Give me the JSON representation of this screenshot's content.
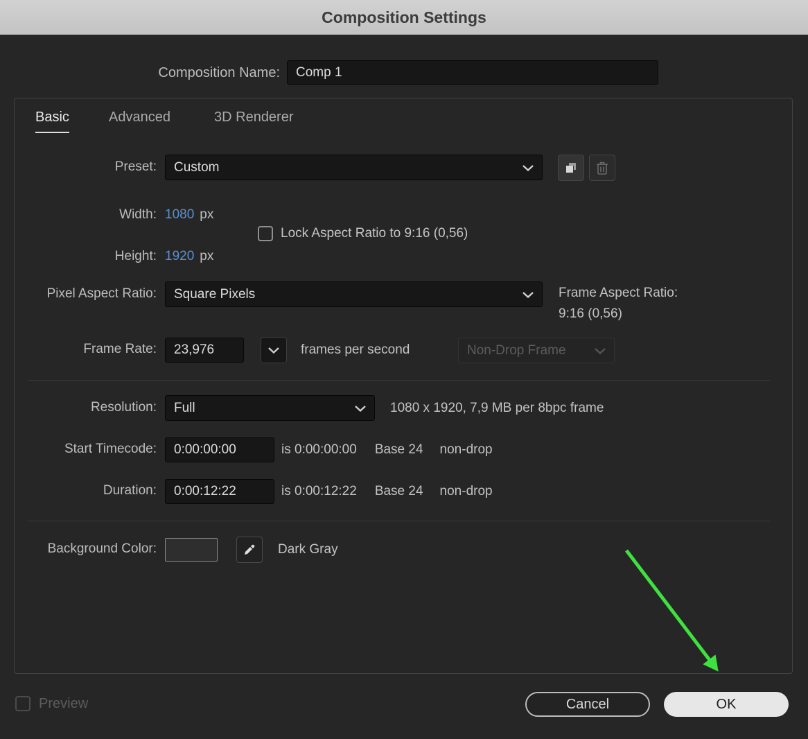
{
  "dialog": {
    "title": "Composition Settings",
    "composition_name": {
      "label": "Composition Name:",
      "value": "Comp 1"
    },
    "tabs": [
      {
        "label": "Basic",
        "active": true
      },
      {
        "label": "Advanced",
        "active": false
      },
      {
        "label": "3D Renderer",
        "active": false
      }
    ],
    "preset": {
      "label": "Preset:",
      "value": "Custom"
    },
    "width": {
      "label": "Width:",
      "value": "1080",
      "unit": "px"
    },
    "lock_aspect_ratio": {
      "label": "Lock Aspect Ratio to 9:16 (0,56)",
      "checked": false
    },
    "height": {
      "label": "Height:",
      "value": "1920",
      "unit": "px"
    },
    "pixel_aspect_ratio": {
      "label": "Pixel Aspect Ratio:",
      "value": "Square Pixels"
    },
    "frame_aspect_ratio": {
      "label": "Frame Aspect Ratio:",
      "value": "9:16 (0,56)"
    },
    "frame_rate": {
      "label": "Frame Rate:",
      "value": "23,976",
      "suffix": "frames per second",
      "dropframe_value": "Non-Drop Frame"
    },
    "resolution": {
      "label": "Resolution:",
      "value": "Full",
      "info": "1080 x 1920, 7,9 MB per 8bpc frame"
    },
    "start_timecode": {
      "label": "Start Timecode:",
      "value": "0:00:00:00",
      "info": "is 0:00:00:00",
      "base": "Base 24",
      "drop": "non-drop"
    },
    "duration": {
      "label": "Duration:",
      "value": "0:00:12:22",
      "info": "is 0:00:12:22",
      "base": "Base 24",
      "drop": "non-drop"
    },
    "background_color": {
      "label": "Background Color:",
      "value": "Dark Gray"
    },
    "preview": {
      "label": "Preview",
      "checked": false
    },
    "buttons": {
      "cancel": "Cancel",
      "ok": "OK"
    }
  },
  "colors": {
    "accent_blue": "#5b8fd4",
    "arrow_green": "#3fe13f",
    "background_swatch": "#2e2e2e"
  }
}
